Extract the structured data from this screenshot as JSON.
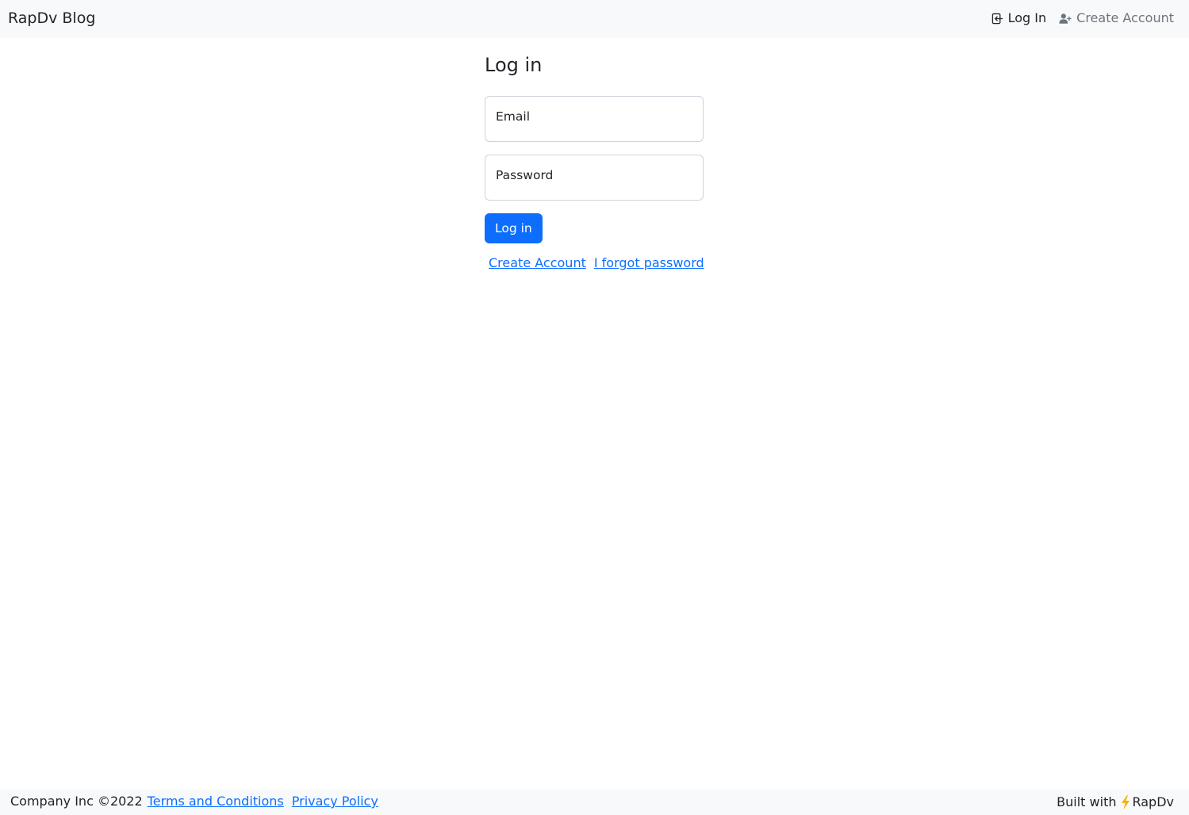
{
  "navbar": {
    "brand": "RapDv Blog",
    "login_label": "Log In",
    "create_account_label": "Create Account"
  },
  "form": {
    "title": "Log in",
    "email_label": "Email",
    "password_label": "Password",
    "submit_label": "Log in",
    "create_account_link": "Create Account",
    "forgot_password_link": "I forgot password"
  },
  "footer": {
    "copyright": "Company Inc ©2022",
    "terms_link": "Terms and Conditions",
    "privacy_link": "Privacy Policy",
    "built_with": "Built with",
    "built_with_brand": "RapDv",
    "bolt_glyph": "⚡"
  },
  "icons": {
    "login": "box-arrow-in-left-icon",
    "create_account": "person-plus-icon",
    "bolt": "lightning-bolt-icon"
  },
  "colors": {
    "primary": "#0d6efd",
    "navbar_bg": "#f8f9fa",
    "muted": "#6c757d",
    "bolt": "#f5b400"
  }
}
